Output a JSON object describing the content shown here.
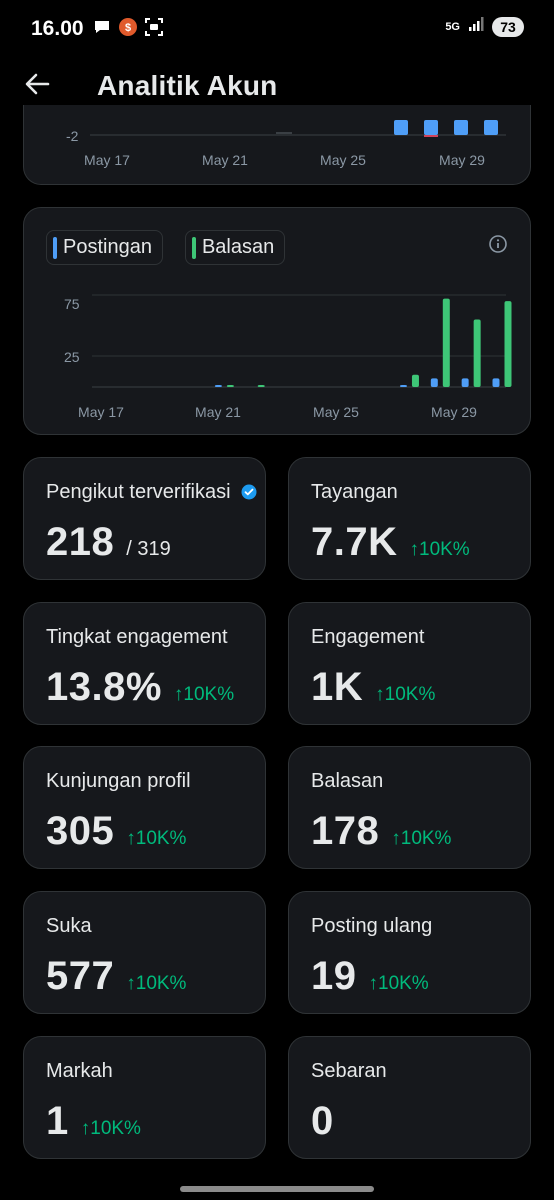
{
  "status_bar": {
    "time": "16.00",
    "network": "5G",
    "battery": "73"
  },
  "header": {
    "title": "Analitik Akun"
  },
  "chart_top": {
    "chart_data": {
      "type": "bar",
      "ytick_labels": [
        "-2"
      ],
      "xtick_labels": [
        "May 17",
        "May 21",
        "May 25",
        "May 29"
      ]
    }
  },
  "chart_bottom": {
    "legend": [
      {
        "label": "Postingan",
        "color": "#4f9ef7"
      },
      {
        "label": "Balasan",
        "color": "#3ec677"
      }
    ],
    "chart_data": {
      "type": "bar",
      "ytick_labels": [
        "75",
        "25"
      ],
      "ylim": [
        0,
        75
      ],
      "xtick_labels": [
        "May 17",
        "May 21",
        "May 25",
        "May 29"
      ],
      "x": [
        "May 17",
        "May 18",
        "May 19",
        "May 20",
        "May 21",
        "May 22",
        "May 23",
        "May 24",
        "May 25",
        "May 26",
        "May 27",
        "May 28",
        "May 29",
        "May 30"
      ],
      "series": [
        {
          "name": "Postingan",
          "color": "#4f9ef7",
          "values": [
            0,
            0,
            0,
            0,
            1,
            0,
            0,
            0,
            0,
            0,
            1,
            7,
            7,
            7
          ]
        },
        {
          "name": "Balasan",
          "color": "#3ec677",
          "values": [
            0,
            0,
            0,
            0,
            1,
            1,
            0,
            0,
            0,
            0,
            10,
            72,
            55,
            70
          ]
        }
      ]
    }
  },
  "stats": [
    {
      "title": "Pengikut terverifikasi",
      "value": "218",
      "sub": "/ 319",
      "delta": "",
      "verified": true
    },
    {
      "title": "Tayangan",
      "value": "7.7K",
      "sub": "",
      "delta": "↑10K%"
    },
    {
      "title": "Tingkat engagement",
      "value": "13.8%",
      "sub": "",
      "delta": "↑10K%"
    },
    {
      "title": "Engagement",
      "value": "1K",
      "sub": "",
      "delta": "↑10K%"
    },
    {
      "title": "Kunjungan profil",
      "value": "305",
      "sub": "",
      "delta": "↑10K%"
    },
    {
      "title": "Balasan",
      "value": "178",
      "sub": "",
      "delta": "↑10K%"
    },
    {
      "title": "Suka",
      "value": "577",
      "sub": "",
      "delta": "↑10K%"
    },
    {
      "title": "Posting ulang",
      "value": "19",
      "sub": "",
      "delta": "↑10K%"
    },
    {
      "title": "Markah",
      "value": "1",
      "sub": "",
      "delta": "↑10K%"
    },
    {
      "title": "Sebaran",
      "value": "0",
      "sub": "",
      "delta": ""
    }
  ]
}
